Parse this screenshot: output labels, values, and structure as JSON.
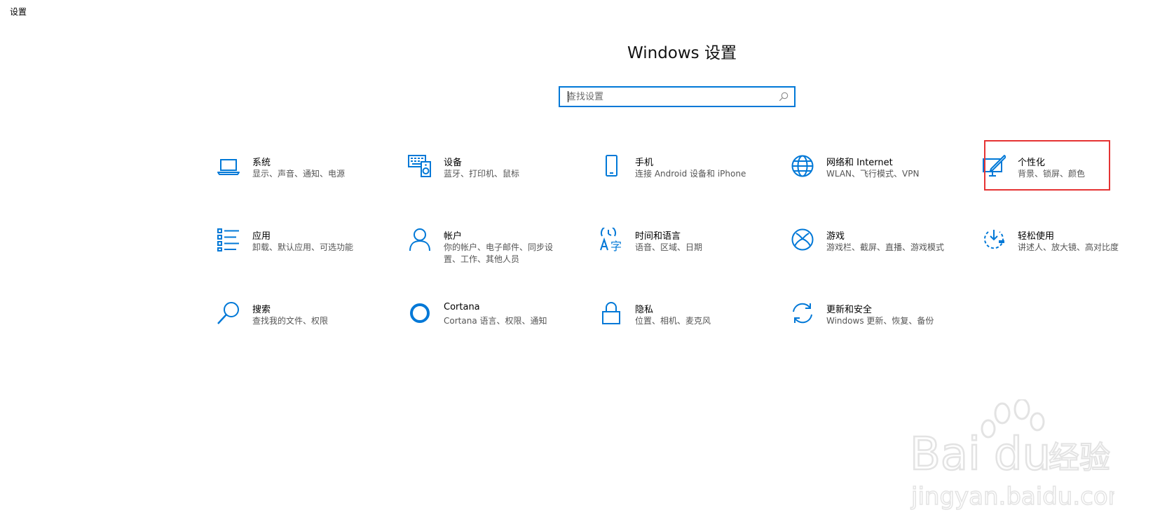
{
  "window": {
    "title": "设置"
  },
  "header": {
    "title": "Windows 设置"
  },
  "search": {
    "placeholder": "查找设置",
    "icon": "search-icon"
  },
  "tiles": [
    {
      "id": "system",
      "title": "系统",
      "desc": "显示、声音、通知、电源",
      "icon": "laptop-icon"
    },
    {
      "id": "devices",
      "title": "设备",
      "desc": "蓝牙、打印机、鼠标",
      "icon": "keyboard-speaker-icon"
    },
    {
      "id": "phone",
      "title": "手机",
      "desc": "连接 Android 设备和 iPhone",
      "icon": "phone-icon"
    },
    {
      "id": "network",
      "title": "网络和 Internet",
      "desc": "WLAN、飞行模式、VPN",
      "icon": "globe-icon"
    },
    {
      "id": "personalization",
      "title": "个性化",
      "desc": "背景、锁屏、颜色",
      "icon": "paintbrush-icon"
    },
    {
      "id": "apps",
      "title": "应用",
      "desc": "卸载、默认应用、可选功能",
      "icon": "app-list-icon"
    },
    {
      "id": "accounts",
      "title": "帐户",
      "desc": "你的帐户、电子邮件、同步设置、工作、其他人员",
      "icon": "person-icon"
    },
    {
      "id": "time-language",
      "title": "时间和语言",
      "desc": "语音、区域、日期",
      "icon": "time-language-icon"
    },
    {
      "id": "gaming",
      "title": "游戏",
      "desc": "游戏栏、截屏、直播、游戏模式",
      "icon": "xbox-icon"
    },
    {
      "id": "ease-of-access",
      "title": "轻松使用",
      "desc": "讲述人、放大镜、高对比度",
      "icon": "ease-of-access-icon"
    },
    {
      "id": "search",
      "title": "搜索",
      "desc": "查找我的文件、权限",
      "icon": "magnifier-icon"
    },
    {
      "id": "cortana",
      "title": "Cortana",
      "desc": "Cortana 语言、权限、通知",
      "icon": "cortana-circle-icon"
    },
    {
      "id": "privacy",
      "title": "隐私",
      "desc": "位置、相机、麦克风",
      "icon": "lock-icon"
    },
    {
      "id": "update-security",
      "title": "更新和安全",
      "desc": "Windows 更新、恢复、备份",
      "icon": "sync-arrows-icon"
    }
  ],
  "colors": {
    "accent": "#0078d7",
    "highlight": "#e53333",
    "title_text": "#000000",
    "desc_text": "#555555"
  },
  "watermark": {
    "brand": "Bai经验",
    "url": "jingyan.baidu.com"
  }
}
